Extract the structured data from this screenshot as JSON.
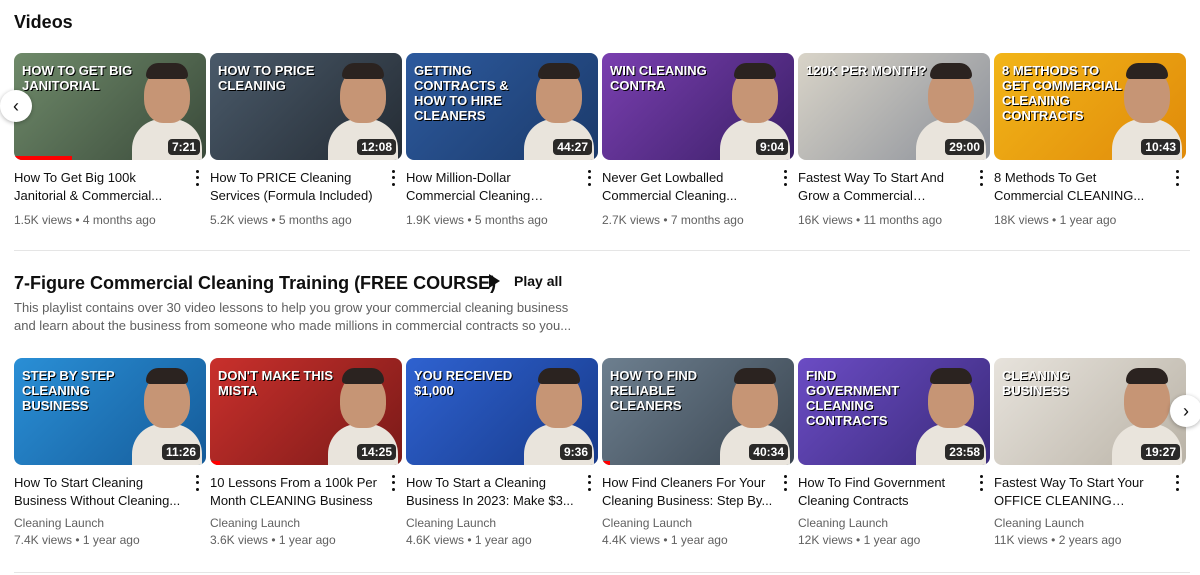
{
  "videos_section": {
    "title": "Videos",
    "items": [
      {
        "title": "How To Get Big 100k Janitorial & Commercial...",
        "duration": "7:21",
        "views": "1.5K views",
        "age": "4 months ago",
        "thumb_text": "How to get big janitorial",
        "thumb_bg": "#6f8a6a",
        "thumb_bg2": "#3a4a3a",
        "progress": 0.3
      },
      {
        "title": "How To PRICE Cleaning Services (Formula Included)",
        "duration": "12:08",
        "views": "5.2K views",
        "age": "5 months ago",
        "thumb_text": "How to price cleaning",
        "thumb_bg": "#4a5a6a",
        "thumb_bg2": "#242b33",
        "progress": 0
      },
      {
        "title": "How Million-Dollar Commercial Cleaning Owne...",
        "duration": "44:27",
        "views": "1.9K views",
        "age": "5 months ago",
        "thumb_text": "Getting contracts & how to hire cleaners",
        "thumb_bg": "#2d5a9e",
        "thumb_bg2": "#1b3a6a",
        "progress": 0
      },
      {
        "title": "Never Get Lowballed Commercial Cleaning...",
        "duration": "9:04",
        "views": "2.7K views",
        "age": "7 months ago",
        "thumb_text": "Win cleaning contra",
        "thumb_bg": "#7a3fb0",
        "thumb_bg2": "#3a1f66",
        "progress": 0
      },
      {
        "title": "Fastest Way To Start And Grow a Commercial Cleanin...",
        "duration": "29:00",
        "views": "16K views",
        "age": "11 months ago",
        "thumb_text": "120K per month?",
        "thumb_bg": "#d9d4c8",
        "thumb_bg2": "#8a8f99",
        "progress": 0
      },
      {
        "title": "8 Methods To Get Commercial CLEANING...",
        "duration": "10:43",
        "views": "18K views",
        "age": "1 year ago",
        "thumb_text": "8 methods to get commercial cleaning contracts",
        "thumb_bg": "#f2b518",
        "thumb_bg2": "#e08a0a",
        "progress": 0
      }
    ]
  },
  "playlist_section": {
    "title": "7-Figure Commercial Cleaning Training (FREE COURSE)",
    "play_all_label": "Play all",
    "description": "This playlist contains over 30 video lessons to help you grow your commercial cleaning business and learn about the business from someone who made millions in commercial contracts so you...",
    "items": [
      {
        "title": "How To Start Cleaning Business Without Cleaning...",
        "duration": "11:26",
        "channel": "Cleaning Launch",
        "views": "7.4K views",
        "age": "1 year ago",
        "thumb_text": "Step by step cleaning business",
        "thumb_bg": "#2a8fd6",
        "thumb_bg2": "#155b99",
        "progress": 0
      },
      {
        "title": "10 Lessons From a 100k Per Month CLEANING Business",
        "duration": "14:25",
        "channel": "Cleaning Launch",
        "views": "3.6K views",
        "age": "1 year ago",
        "thumb_text": "Don't make this mista",
        "thumb_bg": "#c9302c",
        "thumb_bg2": "#7a1a18",
        "progress": 0.05
      },
      {
        "title": "How To Start a Cleaning Business In 2023: Make $3...",
        "duration": "9:36",
        "channel": "Cleaning Launch",
        "views": "4.6K views",
        "age": "1 year ago",
        "thumb_text": "You received $1,000",
        "thumb_bg": "#2f62d0",
        "thumb_bg2": "#173a8a",
        "progress": 0
      },
      {
        "title": "How Find Cleaners For Your Cleaning Business: Step By...",
        "duration": "40:34",
        "channel": "Cleaning Launch",
        "views": "4.4K views",
        "age": "1 year ago",
        "thumb_text": "How to find reliable cleaners",
        "thumb_bg": "#6d7f8f",
        "thumb_bg2": "#3a4550",
        "progress": 0.04
      },
      {
        "title": "How To Find Government Cleaning Contracts",
        "duration": "23:58",
        "channel": "Cleaning Launch",
        "views": "12K views",
        "age": "1 year ago",
        "thumb_text": "Find government cleaning contracts",
        "thumb_bg": "#6b4cc4",
        "thumb_bg2": "#3a2a7a",
        "progress": 0
      },
      {
        "title": "Fastest Way To Start Your OFFICE CLEANING Business",
        "duration": "19:27",
        "channel": "Cleaning Launch",
        "views": "11K views",
        "age": "2 years ago",
        "thumb_text": "Cleaning business",
        "thumb_bg": "#e7e3dc",
        "thumb_bg2": "#b9b2a6",
        "progress": 0
      }
    ]
  },
  "nav": {
    "prev_icon": "‹",
    "next_icon": "›"
  }
}
